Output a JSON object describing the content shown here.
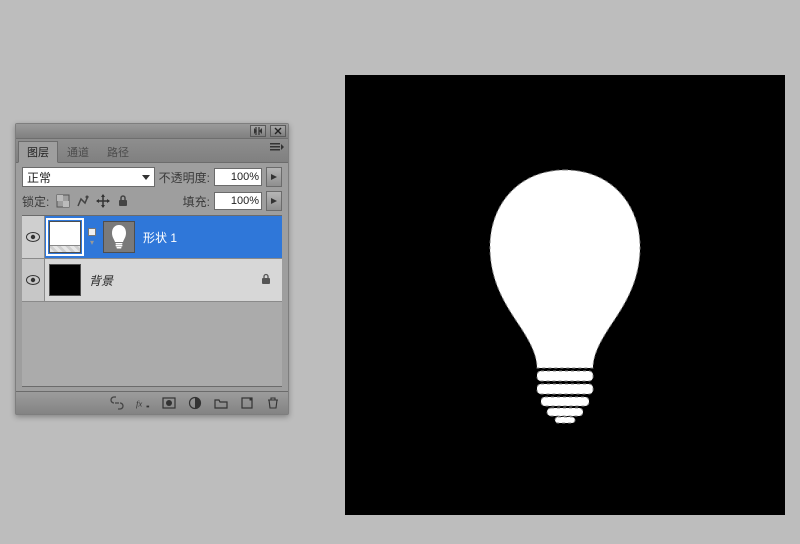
{
  "panel": {
    "tabs": [
      {
        "label": "图层",
        "active": true
      },
      {
        "label": "通道",
        "active": false
      },
      {
        "label": "路径",
        "active": false
      }
    ],
    "blend_mode": {
      "value": "正常"
    },
    "opacity": {
      "label": "不透明度:",
      "value": "100%"
    },
    "fill": {
      "label": "填充:",
      "value": "100%"
    },
    "lock": {
      "label": "锁定:"
    },
    "layers": [
      {
        "name": "形状 1",
        "selected": true,
        "kind": "shape",
        "locked": false
      },
      {
        "name": "背景",
        "selected": false,
        "kind": "background",
        "locked": true
      }
    ]
  }
}
